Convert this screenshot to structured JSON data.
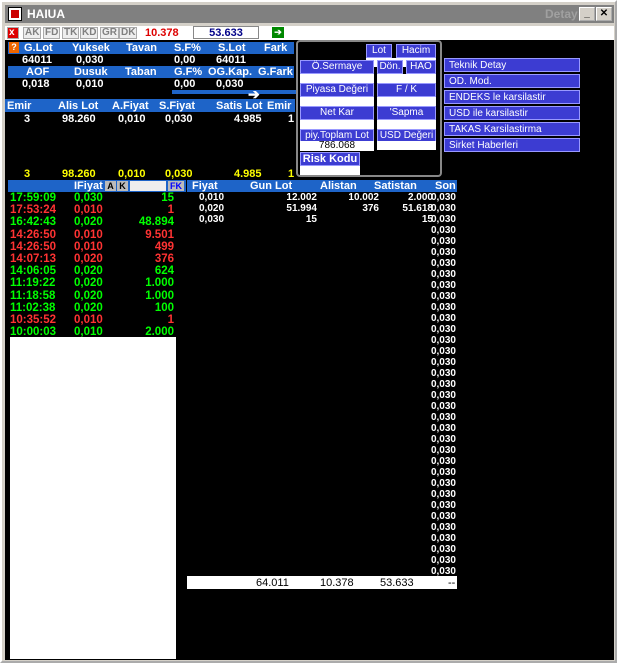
{
  "window": {
    "title": "HAIUA",
    "detay": "Detay"
  },
  "toolbar": {
    "tabs": [
      "AK",
      "FD",
      "TK",
      "KD",
      "GR",
      "DK"
    ],
    "val1": "10.378",
    "val2": "53.633"
  },
  "summary": {
    "h1": [
      "G.Lot",
      "Yuksek",
      "Tavan",
      "S.F%",
      "S.Lot",
      "Fark"
    ],
    "v1": [
      "64011",
      "0,030",
      "",
      "0,00",
      "64011",
      ""
    ],
    "h2": [
      "AOF",
      "Dusuk",
      "Taban",
      "G.F%",
      "OG.Kap.",
      "G.Fark"
    ],
    "v2": [
      "0,018",
      "0,010",
      "",
      "0,00",
      "0,030",
      ""
    ]
  },
  "order": {
    "headers": [
      "Emir",
      "Alis Lot",
      "A.Fiyat",
      "S.Fiyat",
      "Satis Lot",
      "Emir"
    ],
    "row": [
      "3",
      "98.260",
      "0,010",
      "0,030",
      "4.985",
      "1"
    ],
    "total": [
      "3",
      "98.260",
      "0,010",
      "0,030",
      "4.985",
      "1"
    ]
  },
  "panel": {
    "labels": [
      "Lot",
      "Hacim",
      "Ö.Sermaye",
      "Dön.",
      "HAO",
      "Piyasa Değeri",
      "F / K",
      "Net Kar",
      "'Sapma",
      "piy.Toplam Lot",
      "USD Değeri",
      "Risk Kodu"
    ],
    "toplam": "786.068"
  },
  "menu": [
    "Teknik Detay",
    "OD. Mod.",
    "ENDEKS le karsilastir",
    "USD ile karsilastir",
    "TAKAS Karsilastirma",
    "Sirket Haberleri"
  ],
  "trades_header": {
    "fiyat": "IFiyat",
    "a": "A",
    "k": "K",
    "fk": "FK"
  },
  "trades": [
    {
      "time": "17:59:09",
      "price": "0,030",
      "lot": "15",
      "c": "g"
    },
    {
      "time": "17:53:24",
      "price": "0,010",
      "lot": "1",
      "c": "r"
    },
    {
      "time": "16:42:43",
      "price": "0,020",
      "lot": "48.894",
      "c": "g"
    },
    {
      "time": "14:26:50",
      "price": "0,010",
      "lot": "9.501",
      "c": "r"
    },
    {
      "time": "14:26:50",
      "price": "0,010",
      "lot": "499",
      "c": "r"
    },
    {
      "time": "14:07:13",
      "price": "0,020",
      "lot": "376",
      "c": "r"
    },
    {
      "time": "14:06:05",
      "price": "0,020",
      "lot": "624",
      "c": "g"
    },
    {
      "time": "11:19:22",
      "price": "0,020",
      "lot": "1.000",
      "c": "g"
    },
    {
      "time": "11:18:58",
      "price": "0,020",
      "lot": "1.000",
      "c": "g"
    },
    {
      "time": "11:02:38",
      "price": "0,020",
      "lot": "100",
      "c": "g"
    },
    {
      "time": "10:35:52",
      "price": "0,010",
      "lot": "1",
      "c": "r"
    },
    {
      "time": "10:00:03",
      "price": "0,010",
      "lot": "2.000",
      "c": "g"
    }
  ],
  "depth": {
    "headers": [
      "Fiyat",
      "Gun Lot",
      "Alistan",
      "Satistan",
      "Son"
    ],
    "rows": [
      [
        "0,010",
        "12.002",
        "10.002",
        "2.000"
      ],
      [
        "0,020",
        "51.994",
        "376",
        "51.618"
      ],
      [
        "0,030",
        "15",
        "",
        "15"
      ]
    ],
    "son": "0,030",
    "totals": [
      "64.011",
      "10.378",
      "53.633",
      "--"
    ]
  }
}
